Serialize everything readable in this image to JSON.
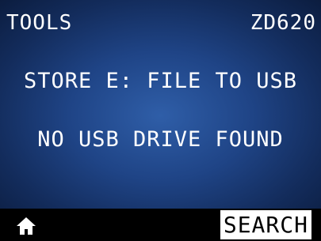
{
  "header": {
    "menu_title": "TOOLS",
    "model": "ZD620"
  },
  "message": {
    "line1": "STORE E: FILE TO USB",
    "line2": "NO USB DRIVE FOUND"
  },
  "softkeys": {
    "left_icon": "home-icon",
    "right_label": "SEARCH"
  },
  "colors": {
    "background_center": "#2f5ea8",
    "background_edge": "#0a1a3a",
    "text": "#ffffff",
    "softkey_bar": "#000000"
  }
}
